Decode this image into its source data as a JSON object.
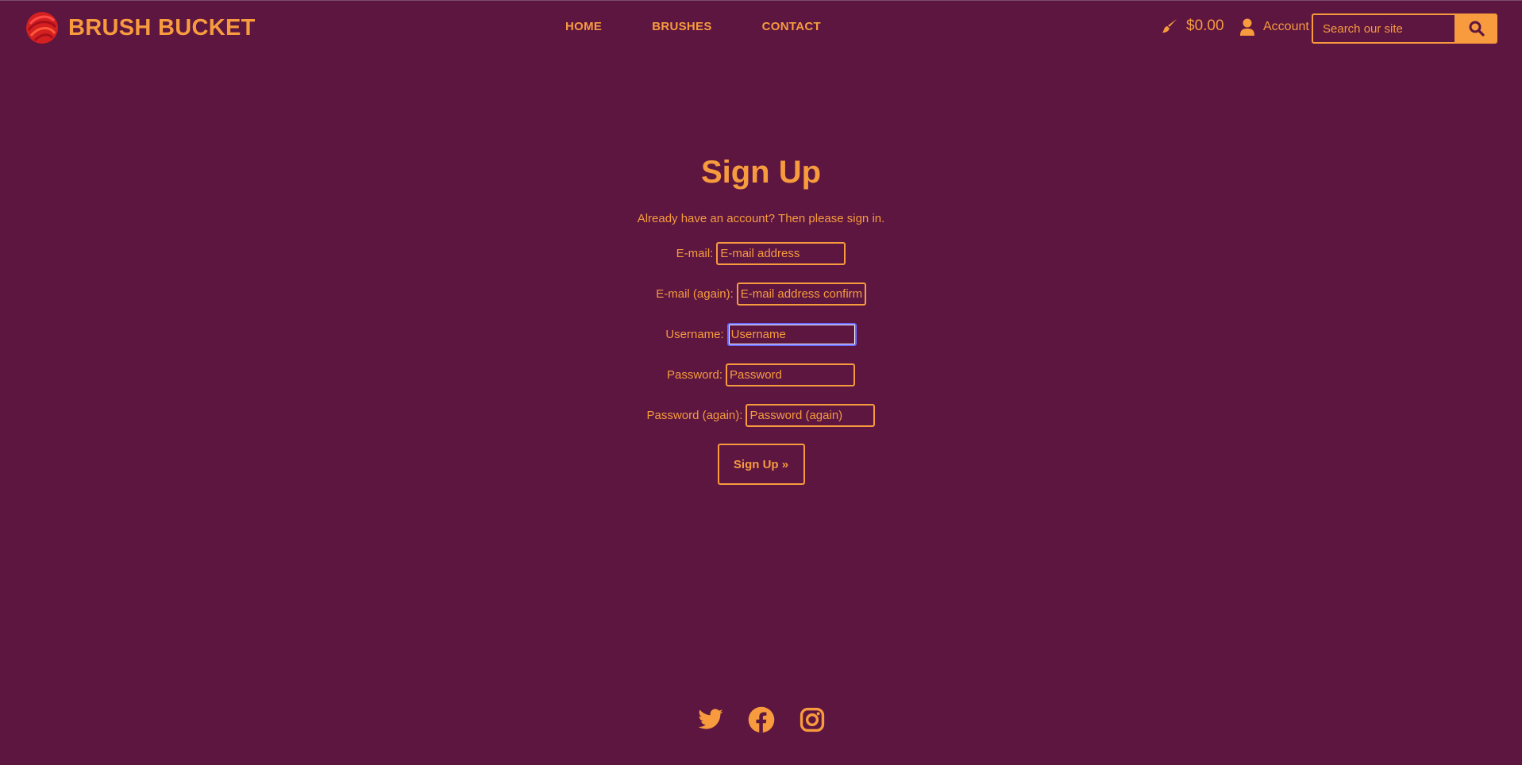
{
  "brand": {
    "name": "BRUSH BUCKET"
  },
  "nav": {
    "items": [
      {
        "label": "HOME"
      },
      {
        "label": "BRUSHES"
      },
      {
        "label": "CONTACT"
      }
    ]
  },
  "cart": {
    "amount": "$0.00",
    "icon": "paintbrush-icon"
  },
  "account": {
    "label": "Account",
    "icon": "user-icon"
  },
  "search": {
    "placeholder": "Search our site",
    "icon": "search-icon"
  },
  "page": {
    "title": "Sign Up",
    "subtitle": "Already have an account? Then please sign in."
  },
  "form": {
    "fields": [
      {
        "label": "E-mail:",
        "placeholder": "E-mail address"
      },
      {
        "label": "E-mail (again):",
        "placeholder": "E-mail address confirmation"
      },
      {
        "label": "Username:",
        "placeholder": "Username"
      },
      {
        "label": "Password:",
        "placeholder": "Password"
      },
      {
        "label": "Password (again):",
        "placeholder": "Password (again)"
      }
    ],
    "submit_label": "Sign Up »"
  },
  "social": {
    "icons": [
      "twitter-icon",
      "facebook-icon",
      "instagram-icon"
    ]
  },
  "colors": {
    "background": "#5c1640",
    "accent": "#f79b3e",
    "focus": "#6a6aff"
  }
}
